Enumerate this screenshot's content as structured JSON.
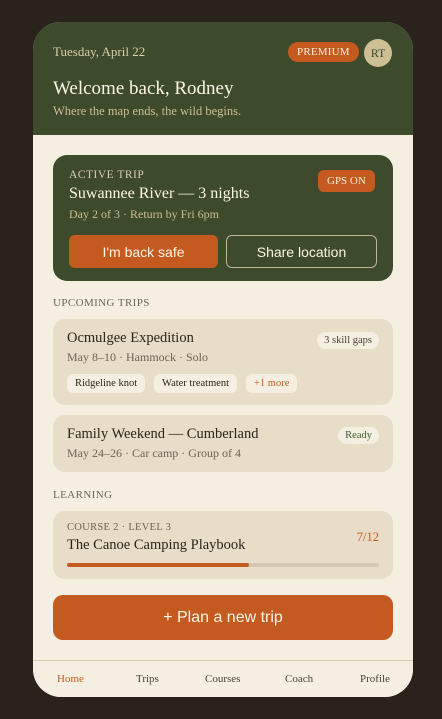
{
  "header": {
    "date": "Tuesday, April 22",
    "premium_badge": "PREMIUM",
    "avatar_initials": "RT",
    "welcome": "Welcome back, Rodney",
    "tagline": "Where the map ends, the wild begins."
  },
  "active_trip": {
    "label": "Active trip",
    "gps_status": "GPS ON",
    "title": "Suwannee River — 3 nights",
    "subtitle": "Day 2 of 3 · Return by Fri 6pm",
    "safe_button": "I'm back safe",
    "share_button": "Share location"
  },
  "upcoming": {
    "section_label": "Upcoming trips",
    "trips": [
      {
        "title": "Ocmulgee Expedition",
        "subtitle": "May 8–10 · Hammock · Solo",
        "badge": "3 skill gaps",
        "chips": [
          "Ridgeline knot",
          "Water treatment",
          "+1 more"
        ]
      },
      {
        "title": "Family Weekend — Cumberland",
        "subtitle": "May 24–26 · Car camp · Group of 4",
        "badge": "Ready"
      }
    ]
  },
  "learning": {
    "section_label": "Learning",
    "course": {
      "eyebrow": "Course 2 · Level 3",
      "title": "The Canoe Camping Playbook",
      "progress_text": "7/12",
      "progress_fraction": 0.583
    }
  },
  "plan_button": "+ Plan a new trip",
  "tabs": [
    {
      "label": "Home",
      "active": true
    },
    {
      "label": "Trips",
      "active": false
    },
    {
      "label": "Courses",
      "active": false
    },
    {
      "label": "Coach",
      "active": false
    },
    {
      "label": "Profile",
      "active": false
    }
  ],
  "colors": {
    "forest": "#3d4a2b",
    "rust": "#c45a1f",
    "cream": "#f5efe1",
    "card": "#e7ddc8"
  }
}
